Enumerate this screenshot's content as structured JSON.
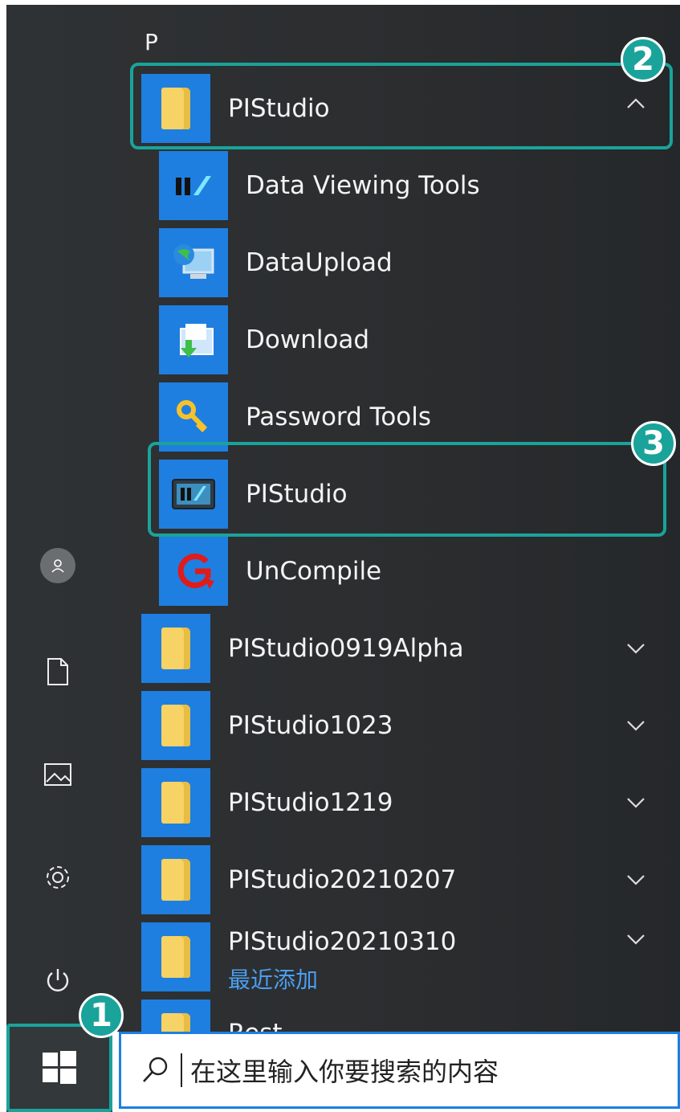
{
  "section_letter": "P",
  "group_header": {
    "label": "PIStudio"
  },
  "group_items": [
    {
      "label": "Data Viewing Tools",
      "icon": "data-viewing-tools-icon"
    },
    {
      "label": "DataUpload",
      "icon": "computer-globe-icon"
    },
    {
      "label": "Download",
      "icon": "download-folder-icon"
    },
    {
      "label": "Password Tools",
      "icon": "key-icon"
    },
    {
      "label": "PIStudio",
      "icon": "pistudio-app-icon"
    },
    {
      "label": "UnCompile",
      "icon": "uncompile-icon"
    }
  ],
  "folders": [
    {
      "label": "PIStudio0919Alpha"
    },
    {
      "label": "PIStudio1023"
    },
    {
      "label": "PIStudio1219"
    },
    {
      "label": "PIStudio20210207"
    },
    {
      "label": "PIStudio20210310",
      "sublabel": "最近添加"
    },
    {
      "label": "Rest"
    }
  ],
  "callouts": {
    "one": "1",
    "two": "2",
    "three": "3"
  },
  "search": {
    "placeholder": "在这里输入你要搜索的内容"
  },
  "colors": {
    "accent": "#1e7fe0",
    "callout": "#1aa39a",
    "recent": "#4a9ef0"
  }
}
